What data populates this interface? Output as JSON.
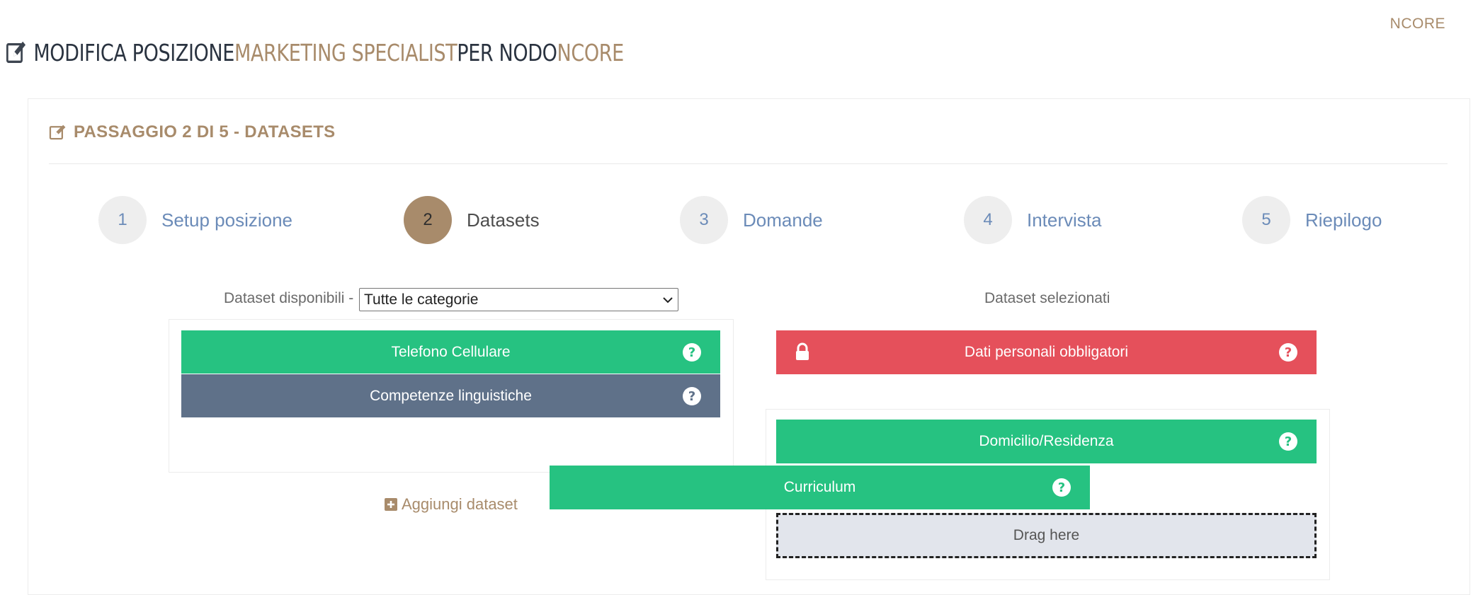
{
  "header": {
    "top_link": "NCORE",
    "title_prefix": "MODIFICA POSIZIONE ",
    "title_position": "MARKETING SPECIALIST",
    "title_middle": " PER NODO ",
    "title_node": "NCORE"
  },
  "panel": {
    "title": "PASSAGGIO 2 DI 5 - DATASETS"
  },
  "wizard": {
    "steps": [
      {
        "number": "1",
        "label": "Setup posizione",
        "active": false
      },
      {
        "number": "2",
        "label": "Datasets",
        "active": true
      },
      {
        "number": "3",
        "label": "Domande",
        "active": false
      },
      {
        "number": "4",
        "label": "Intervista",
        "active": false
      },
      {
        "number": "5",
        "label": "Riepilogo",
        "active": false
      }
    ]
  },
  "available": {
    "label": "Dataset disponibili -",
    "filter_value": "Tutte le categorie",
    "items": [
      {
        "label": "Telefono Cellulare",
        "color": "#26c281"
      },
      {
        "label": "Competenze linguistiche",
        "color": "#5f7189"
      }
    ],
    "add_label": "Aggiungi dataset"
  },
  "dragging": {
    "label": "Curriculum",
    "color": "#26c281"
  },
  "selected": {
    "label": "Dataset selezionati",
    "locked_item": {
      "label": "Dati personali obbligatori",
      "color": "#e5505b"
    },
    "items": [
      {
        "label": "Domicilio/Residenza",
        "color": "#26c281"
      }
    ],
    "drop_zone": "Drag here"
  },
  "colors": {
    "accent": "#a88b6b",
    "step_link": "#6b8bb8"
  }
}
